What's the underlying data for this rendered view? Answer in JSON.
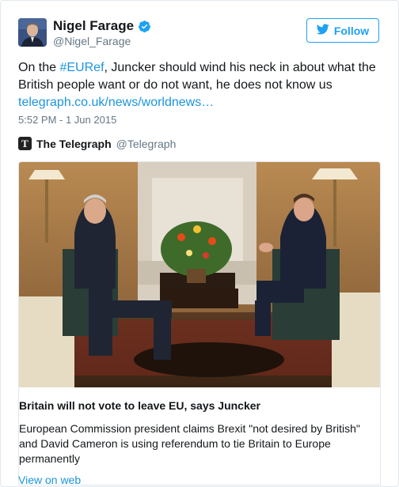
{
  "author": {
    "name": "Nigel Farage",
    "handle": "@Nigel_Farage",
    "verified": true
  },
  "follow_button": {
    "label": "Follow",
    "icon": "twitter-bird-icon"
  },
  "tweet": {
    "text_before": "On the ",
    "hashtag": "#EURef",
    "text_after": ", Juncker should wind his neck in about what the British people want or do not want, he does not know us",
    "link": "telegraph.co.uk/news/worldnews…",
    "timestamp": "5:52 PM - 1 Jun 2015"
  },
  "card": {
    "source_name": "The Telegraph",
    "source_handle": "@Telegraph",
    "source_logo_letter": "T",
    "title": "Britain will not vote to leave EU, says Juncker",
    "description": "European Commission president claims Brexit \"not desired by British\" and David Cameron is using referendum to tie Britain to Europe permanently"
  },
  "view_on_web": "View on web",
  "colors": {
    "link_blue": "#1b95e0",
    "follow_blue": "#1da1f2",
    "verified_blue": "#1da1f2",
    "muted_gray": "#657786"
  }
}
